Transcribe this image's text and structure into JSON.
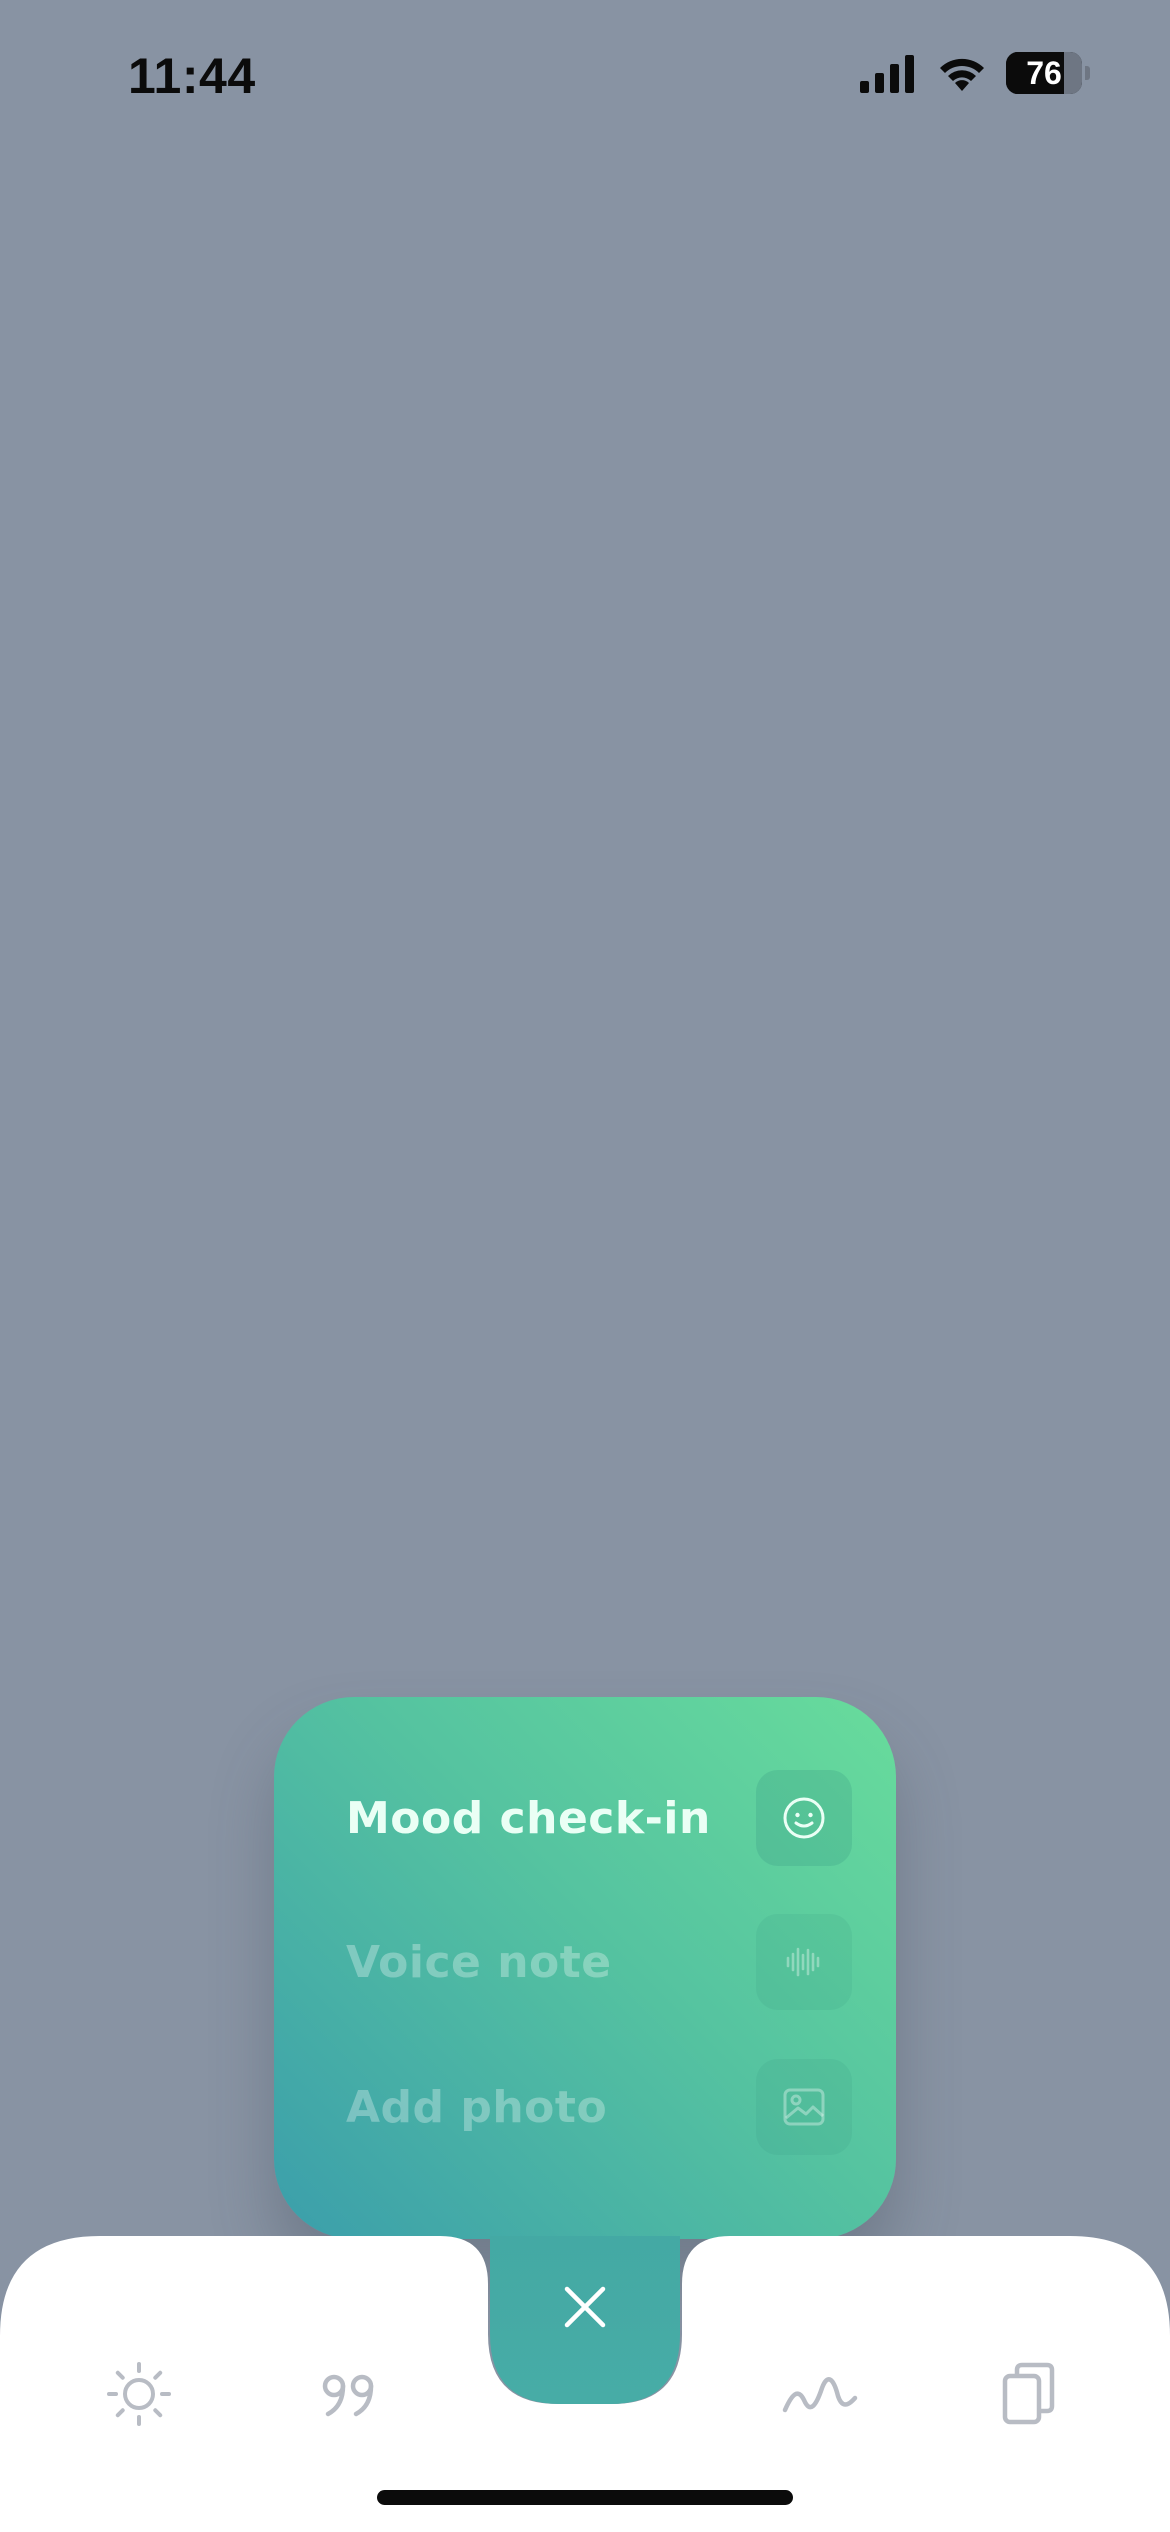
{
  "status_bar": {
    "time": "11:44",
    "battery_percent": 76
  },
  "quick_add_menu": {
    "items": [
      {
        "label": "Mood check-in",
        "icon": "smiley-icon",
        "state": "active"
      },
      {
        "label": "Voice note",
        "icon": "waveform-icon",
        "state": "inactive"
      },
      {
        "label": "Add photo",
        "icon": "image-icon",
        "state": "inactive"
      }
    ]
  },
  "tab_bar": {
    "tabs": [
      {
        "icon": "sun-icon"
      },
      {
        "icon": "quote-icon"
      },
      {
        "icon": "close-icon"
      },
      {
        "icon": "squiggle-chart-icon"
      },
      {
        "icon": "copy-cards-icon"
      }
    ]
  },
  "colors": {
    "backdrop": "#8893a3",
    "menu_gradient_start": "#68dc9c",
    "menu_gradient_end": "#3b9eab",
    "fab": "#47aba7",
    "tab_icon": "#b8bcc4",
    "tab_bar": "#ffffff"
  }
}
